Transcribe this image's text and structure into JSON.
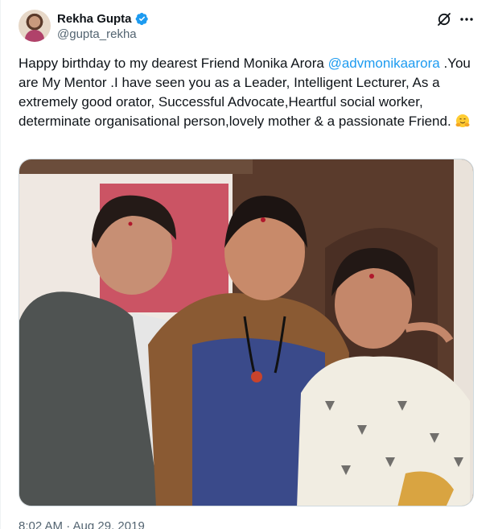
{
  "author": {
    "display_name": "Rekha Gupta",
    "handle": "@gupta_rekha",
    "verified": true,
    "avatar_icon": "profile-avatar"
  },
  "actions": {
    "grok_icon": "grok-icon",
    "more_icon": "more-options-icon"
  },
  "tweet": {
    "text_before": "Happy birthday to my dearest Friend Monika Arora ",
    "mention": "@advmonikaarora",
    "text_after": " .You are My Mentor .I have seen you as a Leader, Intelligent Lecturer, As a extremely good orator, Successful Advocate,Heartful social worker, determinate  organisational person,lovely mother & a passionate Friend. ",
    "emoji": "hugging-face-emoji"
  },
  "media": {
    "type": "photo"
  },
  "meta": {
    "timestamp": "8:02 AM · Aug 29, 2019"
  },
  "colors": {
    "link": "#1d9bf0",
    "verified": "#1d9bf0",
    "secondary_text": "#536471",
    "border": "#cfd9de"
  }
}
